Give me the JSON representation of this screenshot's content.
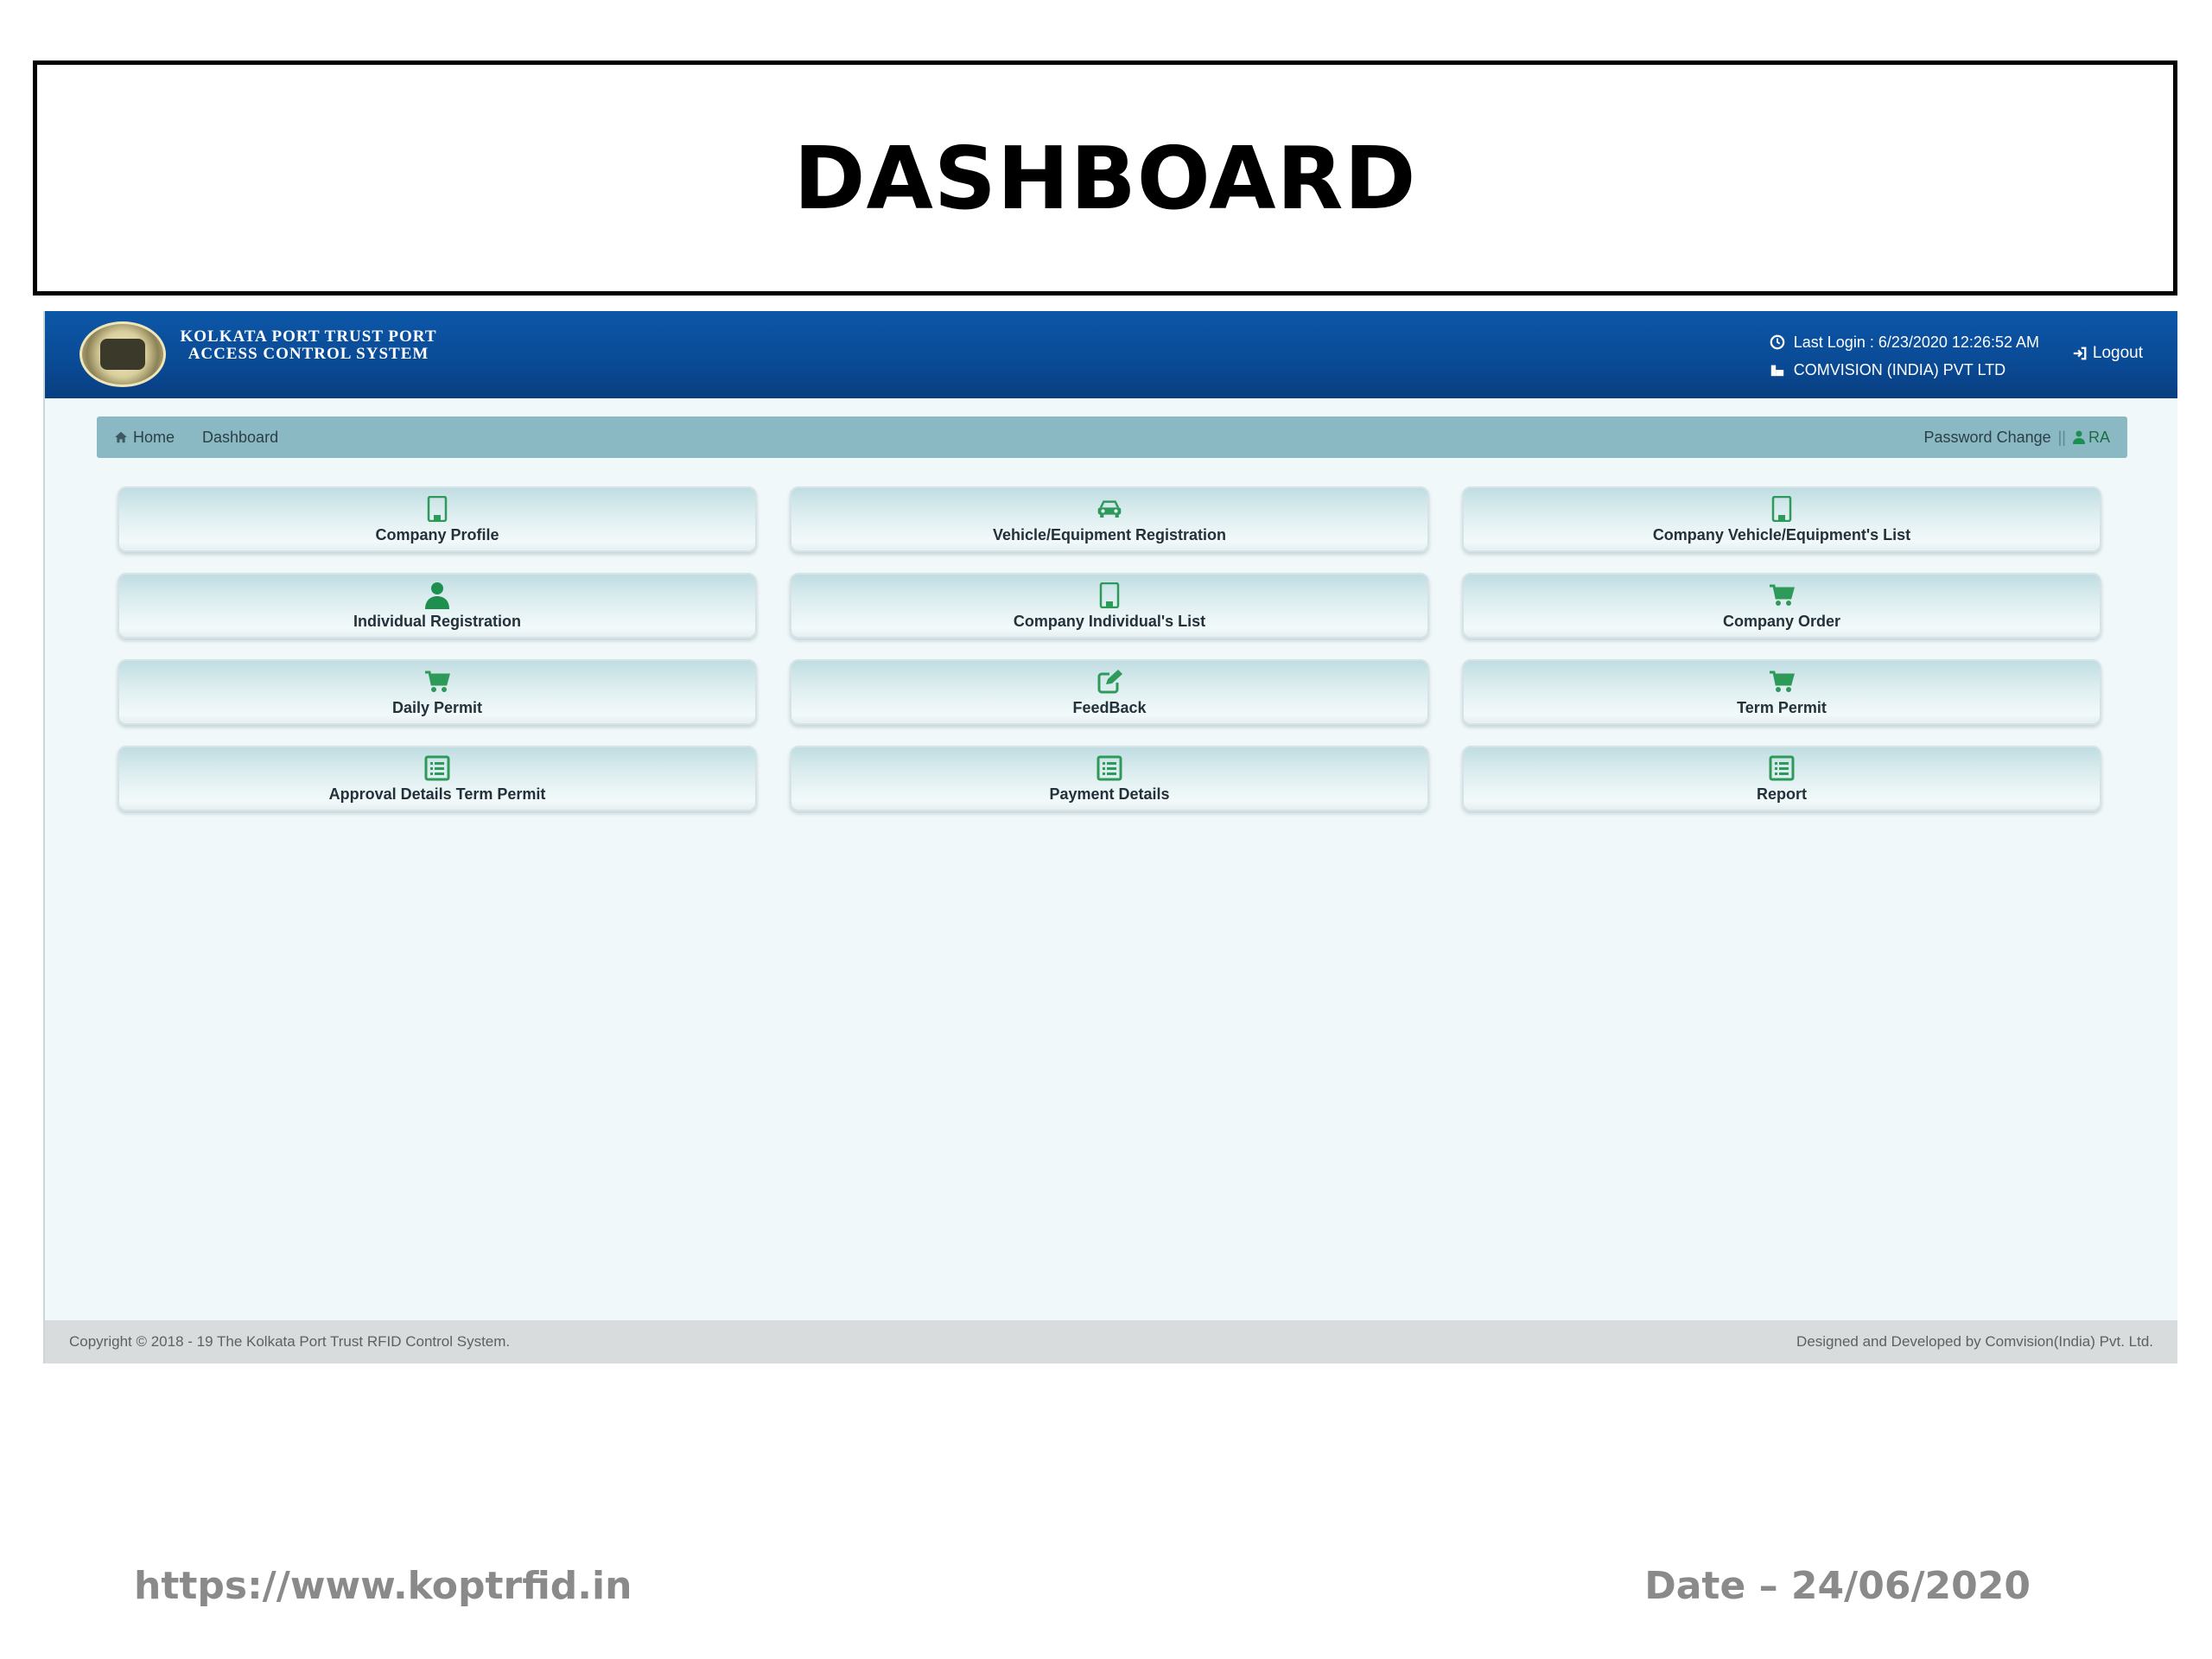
{
  "slide": {
    "title": "DASHBOARD",
    "url": "https://www.koptrfid.in",
    "date": "Date – 24/06/2020"
  },
  "header": {
    "logo_text": "KOLKATA PORT TRUST PORT ACCESS CONTROL SYSTEM",
    "last_login": "Last Login : 6/23/2020 12:26:52 AM",
    "company": "COMVISION (INDIA) PVT LTD",
    "logout_label": "Logout"
  },
  "breadcrumb": {
    "home": "Home",
    "current": "Dashboard",
    "password_change": "Password Change",
    "separator": "||",
    "user": "RA"
  },
  "tiles": [
    {
      "label": "Company Profile",
      "icon": "building-icon"
    },
    {
      "label": "Vehicle/Equipment Registration",
      "icon": "car-icon"
    },
    {
      "label": "Company Vehicle/Equipment's List",
      "icon": "building-icon"
    },
    {
      "label": "Individual Registration",
      "icon": "user-icon"
    },
    {
      "label": "Company Individual's List",
      "icon": "building-icon"
    },
    {
      "label": "Company Order",
      "icon": "cart-icon"
    },
    {
      "label": "Daily Permit",
      "icon": "cart-icon"
    },
    {
      "label": "FeedBack",
      "icon": "edit-icon"
    },
    {
      "label": "Term Permit",
      "icon": "cart-icon"
    },
    {
      "label": "Approval Details Term Permit",
      "icon": "list-icon"
    },
    {
      "label": "Payment Details",
      "icon": "list-icon"
    },
    {
      "label": "Report",
      "icon": "list-icon"
    }
  ],
  "footer": {
    "copyright": "Copyright © 2018 - 19 The Kolkata Port Trust RFID Control System.",
    "credit": "Designed and Developed by Comvision(India) Pvt. Ltd."
  },
  "colors": {
    "header_blue": "#0a4a95",
    "icon_green": "#2e9a5a",
    "breadcrumb_bg": "#8ab9c3"
  }
}
